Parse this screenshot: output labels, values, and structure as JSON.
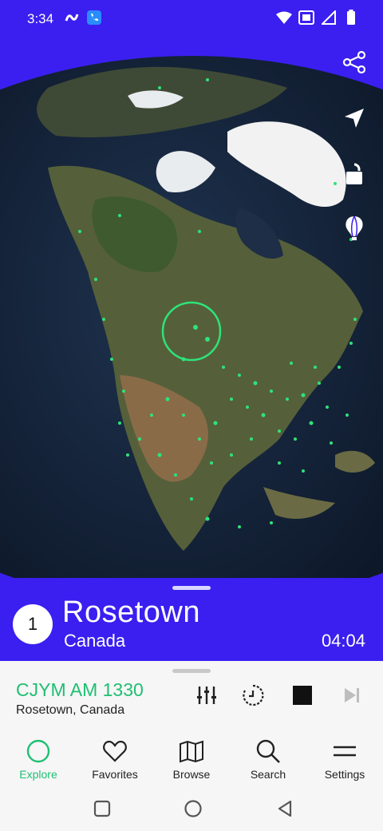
{
  "status": {
    "time": "3:34"
  },
  "map": {
    "background": "#3a1ff0",
    "marker_color": "#2ee37a",
    "icons": [
      "share-icon",
      "locate-icon",
      "lock-open-icon",
      "balloon-icon"
    ]
  },
  "banner": {
    "rank": "1",
    "city": "Rosetown",
    "country": "Canada",
    "time": "04:04"
  },
  "player": {
    "station_name": "CJYM AM 1330",
    "station_location": "Rosetown, Canada",
    "accent": "#1fbf72"
  },
  "nav": {
    "items": [
      {
        "label": "Explore",
        "icon": "explore-circle-icon",
        "active": true
      },
      {
        "label": "Favorites",
        "icon": "heart-icon"
      },
      {
        "label": "Browse",
        "icon": "map-icon"
      },
      {
        "label": "Search",
        "icon": "search-icon"
      },
      {
        "label": "Settings",
        "icon": "menu-icon"
      }
    ]
  }
}
